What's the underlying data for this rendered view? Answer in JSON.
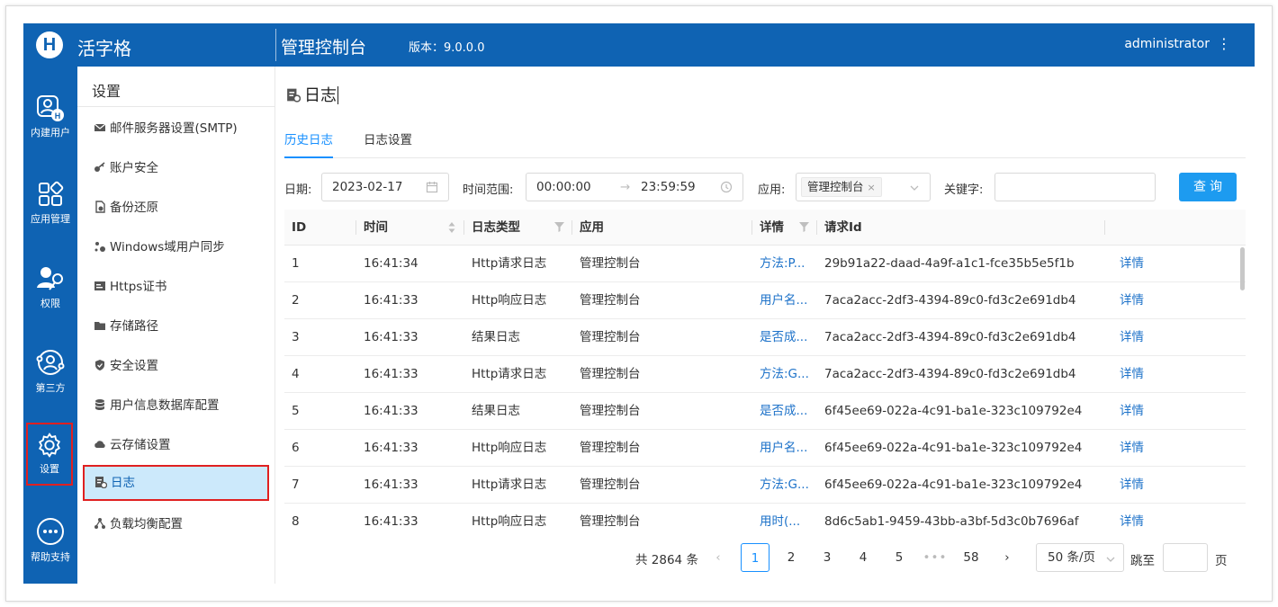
{
  "header": {
    "logo": "H",
    "brand": "活字格",
    "app_title": "管理控制台",
    "version": "版本：9.0.0.0",
    "user": "administrator",
    "more": "⋮"
  },
  "iconbar": {
    "items": [
      {
        "label": "内建用户",
        "icon": "builtin-user-icon"
      },
      {
        "label": "应用管理",
        "icon": "app-grid-icon"
      },
      {
        "label": "权限",
        "icon": "user-key-icon"
      },
      {
        "label": "第三方",
        "icon": "third-party-icon"
      },
      {
        "label": "设置",
        "icon": "gear-icon"
      },
      {
        "label": "帮助支持",
        "icon": "help-icon"
      }
    ]
  },
  "submenu": {
    "title": "设置",
    "items": [
      {
        "label": "邮件服务器设置(SMTP)",
        "icon": "mail-icon"
      },
      {
        "label": "账户安全",
        "icon": "key-icon"
      },
      {
        "label": "备份还原",
        "icon": "backup-icon"
      },
      {
        "label": "Windows域用户同步",
        "icon": "sync-icon"
      },
      {
        "label": "Https证书",
        "icon": "certificate-icon"
      },
      {
        "label": "存储路径",
        "icon": "folder-icon"
      },
      {
        "label": "安全设置",
        "icon": "shield-icon"
      },
      {
        "label": "用户信息数据库配置",
        "icon": "database-icon"
      },
      {
        "label": "云存储设置",
        "icon": "cloud-icon"
      },
      {
        "label": "日志",
        "icon": "log-icon"
      },
      {
        "label": "负载均衡配置",
        "icon": "load-balance-icon"
      }
    ]
  },
  "page": {
    "title": "日志",
    "tabs": [
      "历史日志",
      "日志设置"
    ]
  },
  "filters": {
    "date_label": "日期:",
    "date_value": "2023-02-17",
    "time_label": "时间范围:",
    "time_start": "00:00:00",
    "time_arrow": "→",
    "time_end": "23:59:59",
    "app_label": "应用:",
    "app_tag": "管理控制台",
    "tag_close": "×",
    "keyword_label": "关键字:",
    "keyword_value": "",
    "query_button": "查询"
  },
  "table": {
    "columns": [
      "ID",
      "时间",
      "日志类型",
      "应用",
      "详情",
      "请求Id"
    ],
    "rows": [
      {
        "id": "1",
        "time": "16:41:34",
        "type": "Http请求日志",
        "app": "管理控制台",
        "detail": "方法:P...",
        "request_id": "29b91a22-daad-4a9f-a1c1-fce35b5e5f1b",
        "action": "详情"
      },
      {
        "id": "2",
        "time": "16:41:33",
        "type": "Http响应日志",
        "app": "管理控制台",
        "detail": "用户名...",
        "request_id": "7aca2acc-2df3-4394-89c0-fd3c2e691db4",
        "action": "详情"
      },
      {
        "id": "3",
        "time": "16:41:33",
        "type": "结果日志",
        "app": "管理控制台",
        "detail": "是否成...",
        "request_id": "7aca2acc-2df3-4394-89c0-fd3c2e691db4",
        "action": "详情"
      },
      {
        "id": "4",
        "time": "16:41:33",
        "type": "Http请求日志",
        "app": "管理控制台",
        "detail": "方法:G...",
        "request_id": "7aca2acc-2df3-4394-89c0-fd3c2e691db4",
        "action": "详情"
      },
      {
        "id": "5",
        "time": "16:41:33",
        "type": "结果日志",
        "app": "管理控制台",
        "detail": "是否成...",
        "request_id": "6f45ee69-022a-4c91-ba1e-323c109792e4",
        "action": "详情"
      },
      {
        "id": "6",
        "time": "16:41:33",
        "type": "Http响应日志",
        "app": "管理控制台",
        "detail": "用户名...",
        "request_id": "6f45ee69-022a-4c91-ba1e-323c109792e4",
        "action": "详情"
      },
      {
        "id": "7",
        "time": "16:41:33",
        "type": "Http请求日志",
        "app": "管理控制台",
        "detail": "方法:G...",
        "request_id": "6f45ee69-022a-4c91-ba1e-323c109792e4",
        "action": "详情"
      },
      {
        "id": "8",
        "time": "16:41:33",
        "type": "Http响应日志",
        "app": "管理控制台",
        "detail": "用时(...",
        "request_id": "8d6c5ab1-9459-43bb-a3bf-5d3c0b7696af",
        "action": "详情"
      }
    ]
  },
  "pagination": {
    "total": "共 2864 条",
    "prev": "‹",
    "pages": [
      "1",
      "2",
      "3",
      "4",
      "5"
    ],
    "ellipsis": "•••",
    "last": "58",
    "next": "›",
    "page_size": "50 条/页",
    "jump_label": "跳至",
    "jump_unit": "页"
  },
  "colors": {
    "brand_blue": "#0f63b3",
    "link_blue": "#1d72c9",
    "query_button": "#1d9bf0",
    "highlight_border": "#e02020",
    "active_menu_bg": "#cce9fb"
  }
}
